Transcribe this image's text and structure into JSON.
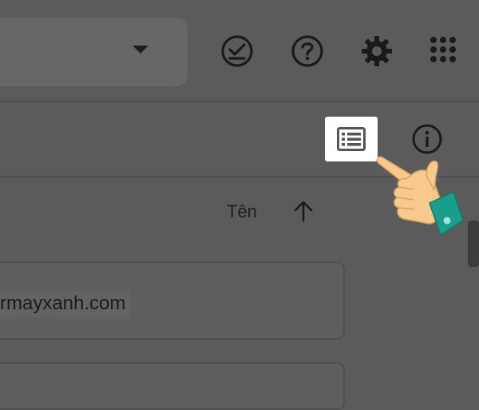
{
  "header": {
    "search": {
      "dropdown_icon": "caret-down-icon"
    },
    "icons": [
      {
        "name": "task-check-icon",
        "label": ""
      },
      {
        "name": "help-icon",
        "label": ""
      },
      {
        "name": "settings-gear-icon",
        "label": ""
      },
      {
        "name": "apps-grid-icon",
        "label": ""
      }
    ]
  },
  "toolbar": {
    "view_toggle_icon": "list-view-icon",
    "info_icon": "info-icon"
  },
  "sort": {
    "label": "Tên",
    "direction_icon": "arrow-up-icon"
  },
  "list": {
    "items": [
      {
        "email": "rmayxanh.com"
      }
    ]
  },
  "overlay": {
    "pointer": "pointing-hand-icon"
  },
  "colors": {
    "dim_background": "#5b5b5b",
    "highlight": "#ffffff",
    "hand_skin": "#f7c98a",
    "hand_cuff": "#1a9e8c"
  }
}
